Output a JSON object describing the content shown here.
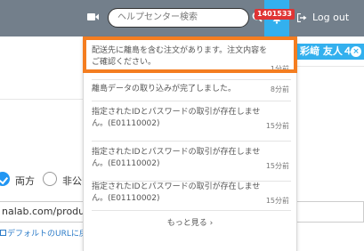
{
  "topbar": {
    "search_placeholder": "ヘルプセンター検索",
    "notification_count": "1401533",
    "logout_label": "Log out"
  },
  "background": {
    "user_name": "彩﨑 友人４",
    "radio_both_label": "両方",
    "radio_private_label": "非公開",
    "url_value": "nalab.com/products",
    "default_url_link": "デフォルトのURLに戻"
  },
  "notifications": {
    "items": [
      {
        "text": "配送先に離島を含む注文があります。注文内容をご確認ください。",
        "time": "1分前"
      },
      {
        "text": "離島データの取り込みが完了しました。",
        "time": "8分前"
      },
      {
        "text": "指定されたIDとパスワードの取引が存在しません。(E01110002)",
        "time": "15分前"
      },
      {
        "text": "指定されたIDとパスワードの取引が存在しません。(E01110002)",
        "time": "15分前"
      },
      {
        "text": "指定されたIDとパスワードの取引が存在しません。(E01110002)",
        "time": "15分前"
      }
    ],
    "more_label": "もっと見る ›"
  },
  "colors": {
    "topbar": "#737f8b",
    "accent": "#33b0ee",
    "badge": "#e03434",
    "highlight": "#f47d20"
  }
}
